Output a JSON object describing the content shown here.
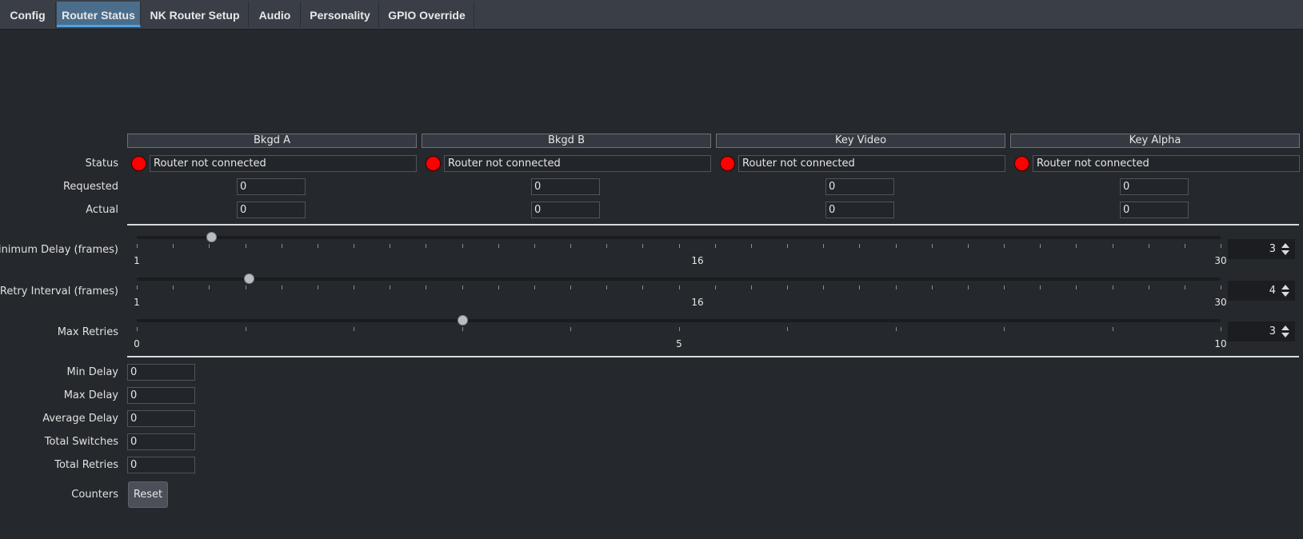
{
  "tabs": [
    {
      "label": "Config",
      "active": false
    },
    {
      "label": "Router Status",
      "active": true
    },
    {
      "label": "NK Router Setup",
      "active": false
    },
    {
      "label": "Audio",
      "active": false
    },
    {
      "label": "Personality",
      "active": false
    },
    {
      "label": "GPIO Override",
      "active": false
    }
  ],
  "channels": [
    {
      "name": "Bkgd A",
      "status": "Router not connected",
      "requested": "0",
      "actual": "0"
    },
    {
      "name": "Bkgd B",
      "status": "Router not connected",
      "requested": "0",
      "actual": "0"
    },
    {
      "name": "Key Video",
      "status": "Router not connected",
      "requested": "0",
      "actual": "0"
    },
    {
      "name": "Key Alpha",
      "status": "Router not connected",
      "requested": "0",
      "actual": "0"
    }
  ],
  "row_labels": {
    "status": "Status",
    "requested": "Requested",
    "actual": "Actual"
  },
  "status_color": "#ff0000",
  "sliders": [
    {
      "label": "Minimum Delay (frames)",
      "min": 1,
      "max": 30,
      "mid": 16,
      "value": 3,
      "value_text": "3"
    },
    {
      "label": "Retry Interval (frames)",
      "min": 1,
      "max": 30,
      "mid": 16,
      "value": 4,
      "value_text": "4"
    },
    {
      "label": "Max Retries",
      "min": 0,
      "max": 10,
      "mid": 5,
      "value": 3,
      "value_text": "3"
    }
  ],
  "stats": [
    {
      "label": "Min Delay",
      "value": "0"
    },
    {
      "label": "Max Delay",
      "value": "0"
    },
    {
      "label": "Average Delay",
      "value": "0"
    },
    {
      "label": "Total Switches",
      "value": "0"
    },
    {
      "label": "Total Retries",
      "value": "0"
    }
  ],
  "counters": {
    "label": "Counters",
    "reset_label": "Reset"
  }
}
